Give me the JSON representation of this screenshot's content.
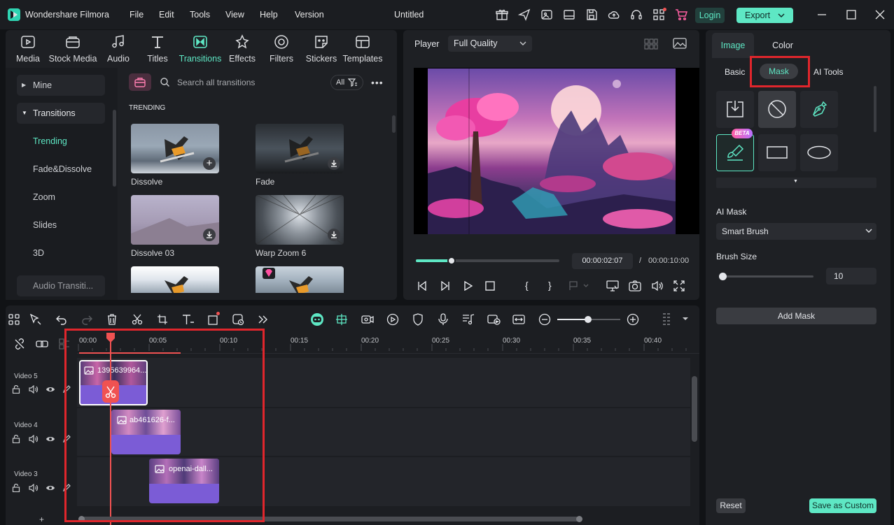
{
  "app": {
    "name": "Wondershare Filmora",
    "doc_title": "Untitled"
  },
  "menu": [
    "File",
    "Edit",
    "Tools",
    "View",
    "Help",
    "Version"
  ],
  "header": {
    "login_label": "Login",
    "export_label": "Export"
  },
  "toolbar_tabs": [
    {
      "label": "Media",
      "icon": "media-icon"
    },
    {
      "label": "Stock Media",
      "icon": "stock-media-icon"
    },
    {
      "label": "Audio",
      "icon": "audio-icon"
    },
    {
      "label": "Titles",
      "icon": "titles-icon"
    },
    {
      "label": "Transitions",
      "icon": "transitions-icon",
      "active": true
    },
    {
      "label": "Effects",
      "icon": "effects-icon"
    },
    {
      "label": "Filters",
      "icon": "filters-icon"
    },
    {
      "label": "Stickers",
      "icon": "stickers-icon"
    },
    {
      "label": "Templates",
      "icon": "templates-icon"
    }
  ],
  "sidebar": {
    "items": [
      "Mine",
      "Transitions",
      "Trending",
      "Fade&Dissolve",
      "Zoom",
      "Slides",
      "3D",
      "Audio Transiti..."
    ]
  },
  "library": {
    "search_placeholder": "Search all transitions",
    "filter_label": "All",
    "section_title": "TRENDING",
    "thumbnails": [
      "Dissolve",
      "Fade",
      "Dissolve 03",
      "Warp Zoom 6"
    ]
  },
  "player": {
    "label": "Player",
    "quality": "Full Quality",
    "current_time": "00:00:02:07",
    "separator": "/",
    "total_time": "00:00:10:00",
    "progress": 0.25
  },
  "timeline": {
    "ticks": [
      "00:00",
      "00:05",
      "00:10",
      "00:15",
      "00:20",
      "00:25",
      "00:30",
      "00:35",
      "00:40"
    ],
    "tracks": [
      {
        "label": "Video 5",
        "clip": "1395639964..."
      },
      {
        "label": "Video 4",
        "clip": "ab461626-f..."
      },
      {
        "label": "Video 3",
        "clip": "openai-dall..."
      }
    ]
  },
  "right_panel": {
    "tabs": [
      "Image",
      "Color"
    ],
    "subtabs": [
      "Basic",
      "Mask",
      "AI Tools"
    ],
    "beta_label": "BETA",
    "ai_mask_label": "AI Mask",
    "ai_mask_value": "Smart Brush",
    "brush_size_label": "Brush Size",
    "brush_size_value": "10",
    "add_mask_label": "Add Mask",
    "reset_label": "Reset",
    "save_label": "Save as Custom"
  },
  "colors": {
    "accent": "#5ee7c4",
    "highlight": "#e0262c",
    "clip": "#7b5cd6",
    "playhead": "#f05252"
  }
}
